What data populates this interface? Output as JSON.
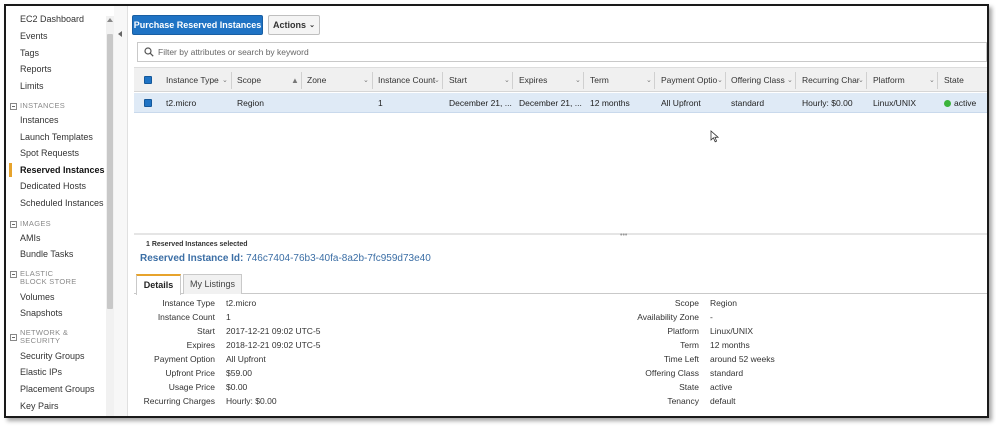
{
  "sidebar": {
    "items": [
      {
        "label": "EC2 Dashboard"
      },
      {
        "label": "Events"
      },
      {
        "label": "Tags"
      },
      {
        "label": "Reports"
      },
      {
        "label": "Limits"
      }
    ],
    "instances_header": "INSTANCES",
    "instances": [
      {
        "label": "Instances"
      },
      {
        "label": "Launch Templates"
      },
      {
        "label": "Spot Requests"
      },
      {
        "label": "Reserved Instances"
      },
      {
        "label": "Dedicated Hosts"
      },
      {
        "label": "Scheduled Instances"
      }
    ],
    "images_header": "IMAGES",
    "images": [
      {
        "label": "AMIs"
      },
      {
        "label": "Bundle Tasks"
      }
    ],
    "ebs_header": "ELASTIC BLOCK STORE",
    "ebs": [
      {
        "label": "Volumes"
      },
      {
        "label": "Snapshots"
      }
    ],
    "network_header": "NETWORK & SECURITY",
    "network": [
      {
        "label": "Security Groups"
      },
      {
        "label": "Elastic IPs"
      },
      {
        "label": "Placement Groups"
      },
      {
        "label": "Key Pairs"
      }
    ]
  },
  "toolbar": {
    "purchase_label": "Purchase Reserved Instances",
    "actions_label": "Actions"
  },
  "search": {
    "placeholder": "Filter by attributes or search by keyword"
  },
  "table": {
    "columns": [
      "Instance Type",
      "Scope",
      "Zone",
      "Instance Count",
      "Start",
      "Expires",
      "Term",
      "Payment Optio",
      "Offering Class",
      "Recurring Char",
      "Platform",
      "State"
    ],
    "row": {
      "instance_type": "t2.micro",
      "scope": "Region",
      "zone": "",
      "instance_count": "1",
      "start": "December 21, ...",
      "expires": "December 21, ...",
      "term": "12 months",
      "payment_option": "All Upfront",
      "offering_class": "standard",
      "recurring_charges": "Hourly: $0.00",
      "platform": "Linux/UNIX",
      "state": "active"
    }
  },
  "details": {
    "selected_count": "1 Reserved Instances selected",
    "id_label": "Reserved Instance Id:",
    "id_value": "746c7404-76b3-40fa-8a2b-7fc959d73e40",
    "tabs": [
      "Details",
      "My Listings"
    ],
    "left": [
      {
        "label": "Instance Type",
        "value": "t2.micro"
      },
      {
        "label": "Instance Count",
        "value": "1"
      },
      {
        "label": "Start",
        "value": "2017-12-21 09:02 UTC-5"
      },
      {
        "label": "Expires",
        "value": "2018-12-21 09:02 UTC-5"
      },
      {
        "label": "Payment Option",
        "value": "All Upfront"
      },
      {
        "label": "Upfront Price",
        "value": "$59.00"
      },
      {
        "label": "Usage Price",
        "value": "$0.00"
      },
      {
        "label": "Recurring Charges",
        "value": "Hourly: $0.00"
      }
    ],
    "right": [
      {
        "label": "Scope",
        "value": "Region"
      },
      {
        "label": "Availability Zone",
        "value": "-"
      },
      {
        "label": "Platform",
        "value": "Linux/UNIX"
      },
      {
        "label": "Term",
        "value": "12 months"
      },
      {
        "label": "Time Left",
        "value": "around 52 weeks"
      },
      {
        "label": "Offering Class",
        "value": "standard"
      },
      {
        "label": "State",
        "value": "active"
      },
      {
        "label": "Tenancy",
        "value": "default"
      }
    ]
  },
  "colors": {
    "primary_button": "#1f73c4",
    "selected_row": "#dfeaf6",
    "active_accent": "#e7a32c",
    "status_active": "#3bb43b",
    "link": "#3b6ea5"
  }
}
